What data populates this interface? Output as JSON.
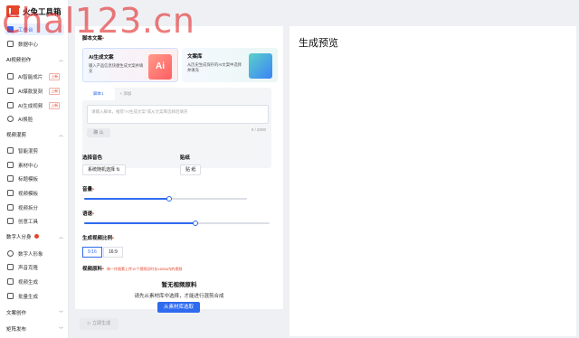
{
  "app": {
    "title": "火兔工具箱",
    "watermark": "chal123.cn"
  },
  "sidebar": {
    "items_top": [
      {
        "label": "工作台",
        "icon": "home-icon"
      },
      {
        "label": "数据中心",
        "icon": "chart-icon"
      }
    ],
    "group_ai_video": {
      "title": "AI视频创作",
      "items": [
        {
          "label": "AI智能成片",
          "badge": "上新"
        },
        {
          "label": "AI爆款复刻",
          "badge": "上新"
        },
        {
          "label": "AI生成视频",
          "badge": "上新"
        },
        {
          "label": "AI换脸",
          "badge": ""
        }
      ]
    },
    "group_mix": {
      "title": "视频混剪",
      "items": [
        {
          "label": "智能混剪"
        },
        {
          "label": "素材中心"
        },
        {
          "label": "标题模板"
        },
        {
          "label": "视频模板"
        },
        {
          "label": "视频拆分"
        },
        {
          "label": "创意工具"
        }
      ]
    },
    "group_digital": {
      "title": "数字人分身",
      "items": [
        {
          "label": "数字人形象"
        },
        {
          "label": "声音克隆"
        },
        {
          "label": "视频生成"
        },
        {
          "label": "批量生成"
        }
      ]
    },
    "group_copy": {
      "title": "文案创作"
    },
    "group_matrix": {
      "title": "矩阵发布"
    }
  },
  "form": {
    "script_label": "脚本文案",
    "card_ai": {
      "title": "AI生成文案",
      "desc": "输入产品信息快捷生成文案并填充",
      "art": "Ai"
    },
    "card_lib": {
      "title": "文案库",
      "desc": "从历史生成保存的AI文案中选择并填充"
    },
    "tab_script": "脚本1",
    "tab_add": "+ 添加",
    "textarea_placeholder": "请输入脚本，推荐\"AI生成文案\"或从文案库选择后填充",
    "confirm_label": "确 认",
    "char_count": "0 / 2000",
    "voice_label": "选择音色",
    "voice_value": "系统随机选择 ⇅",
    "subtitle_label": "贴纸",
    "subtitle_value": "贴 纸",
    "volume_label": "音量",
    "volume_level": 0.52,
    "speed_label": "语速",
    "speed_level": 0.6,
    "ratio_label": "生成视频比例",
    "ratio_options": [
      "9:16",
      "16:9"
    ],
    "ratio_selected": "9:16",
    "material_label": "视频原料",
    "material_note": "每一作限素上传10个视频总时长≤600s内的视频",
    "empty_title": "暂无视频原料",
    "empty_desc": "请先从素材库中选择，才能进行混剪合成",
    "select_btn": "从素材库选取",
    "generate_btn": "立即生成"
  },
  "preview": {
    "title": "生成预览"
  },
  "colors": {
    "accent": "#2f6bef",
    "brand": "#e5462c"
  }
}
